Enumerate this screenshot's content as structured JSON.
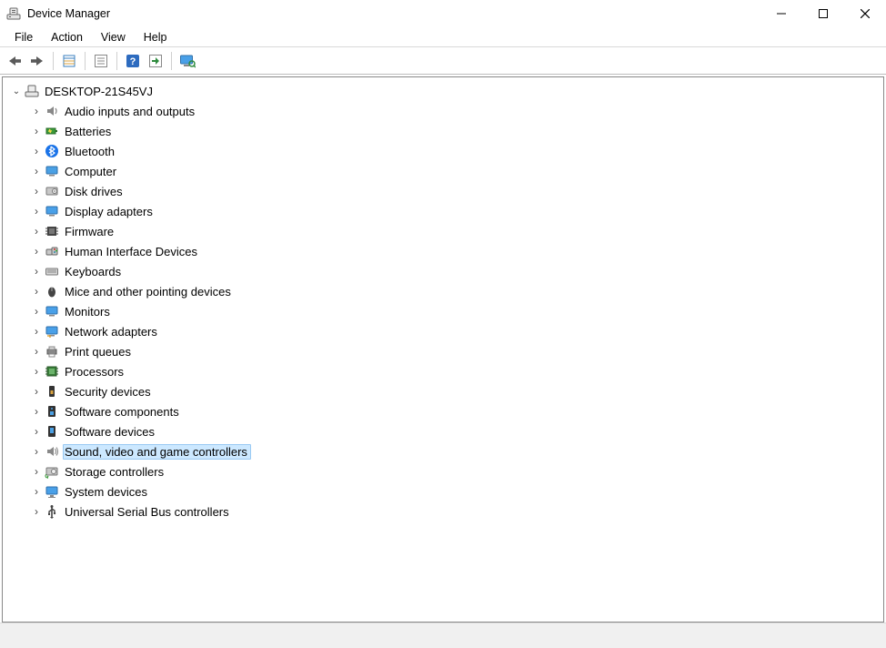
{
  "window": {
    "title": "Device Manager"
  },
  "menus": {
    "file": "File",
    "action": "Action",
    "view": "View",
    "help": "Help"
  },
  "toolbar": {
    "back": "Back",
    "forward": "Forward",
    "properties": "Properties",
    "details": "Details",
    "helpbtn": "Help",
    "updatescan": "Scan for hardware changes",
    "showhidden": "Show hidden"
  },
  "tree": {
    "root_label": "DESKTOP-21S45VJ",
    "categories": [
      {
        "id": "audio",
        "label": "Audio inputs and outputs"
      },
      {
        "id": "batteries",
        "label": "Batteries"
      },
      {
        "id": "bluetooth",
        "label": "Bluetooth"
      },
      {
        "id": "computer",
        "label": "Computer"
      },
      {
        "id": "disk",
        "label": "Disk drives"
      },
      {
        "id": "display",
        "label": "Display adapters"
      },
      {
        "id": "firmware",
        "label": "Firmware"
      },
      {
        "id": "hid",
        "label": "Human Interface Devices"
      },
      {
        "id": "keyboards",
        "label": "Keyboards"
      },
      {
        "id": "mice",
        "label": "Mice and other pointing devices"
      },
      {
        "id": "monitors",
        "label": "Monitors"
      },
      {
        "id": "network",
        "label": "Network adapters"
      },
      {
        "id": "print",
        "label": "Print queues"
      },
      {
        "id": "processors",
        "label": "Processors"
      },
      {
        "id": "security",
        "label": "Security devices"
      },
      {
        "id": "swcomp",
        "label": "Software components"
      },
      {
        "id": "swdev",
        "label": "Software devices"
      },
      {
        "id": "sound",
        "label": "Sound, video and game controllers",
        "selected": true
      },
      {
        "id": "storage",
        "label": "Storage controllers"
      },
      {
        "id": "system",
        "label": "System devices"
      },
      {
        "id": "usb",
        "label": "Universal Serial Bus controllers"
      }
    ]
  }
}
